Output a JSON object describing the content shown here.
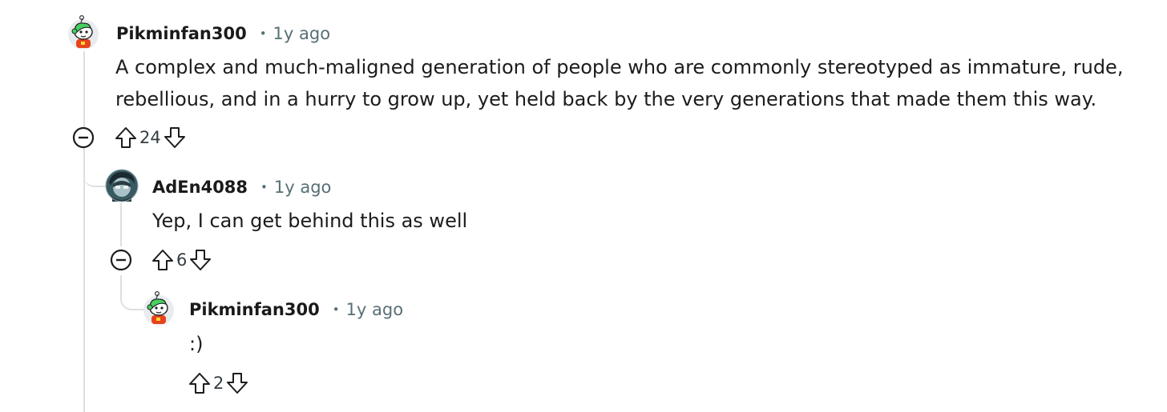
{
  "comments": [
    {
      "username": "Pikminfan300",
      "separator": "•",
      "time": "1y ago",
      "body_lines": [
        "A complex and much-maligned generation of people who are commonly stereotyped as immature, rude,",
        "rebellious, and in a hurry to grow up, yet held back by the very generations that made them this way."
      ],
      "score": "24"
    },
    {
      "username": "AdEn4088",
      "separator": "•",
      "time": "1y ago",
      "body_lines": [
        "Yep, I can get behind this as well"
      ],
      "score": "6"
    },
    {
      "username": "Pikminfan300",
      "separator": "•",
      "time": "1y ago",
      "body_lines": [
        ":)"
      ],
      "score": "2"
    }
  ],
  "icons": {
    "upvote": "arrow-up-outline-icon",
    "downvote": "arrow-down-outline-icon",
    "collapse": "minus-circle-icon"
  },
  "colors": {
    "text": "#1c1c1c",
    "meta": "#576f76",
    "thread_line": "#dcdfe2",
    "avatar_shirt": "#e8421c",
    "avatar_hat": "#46d160"
  }
}
